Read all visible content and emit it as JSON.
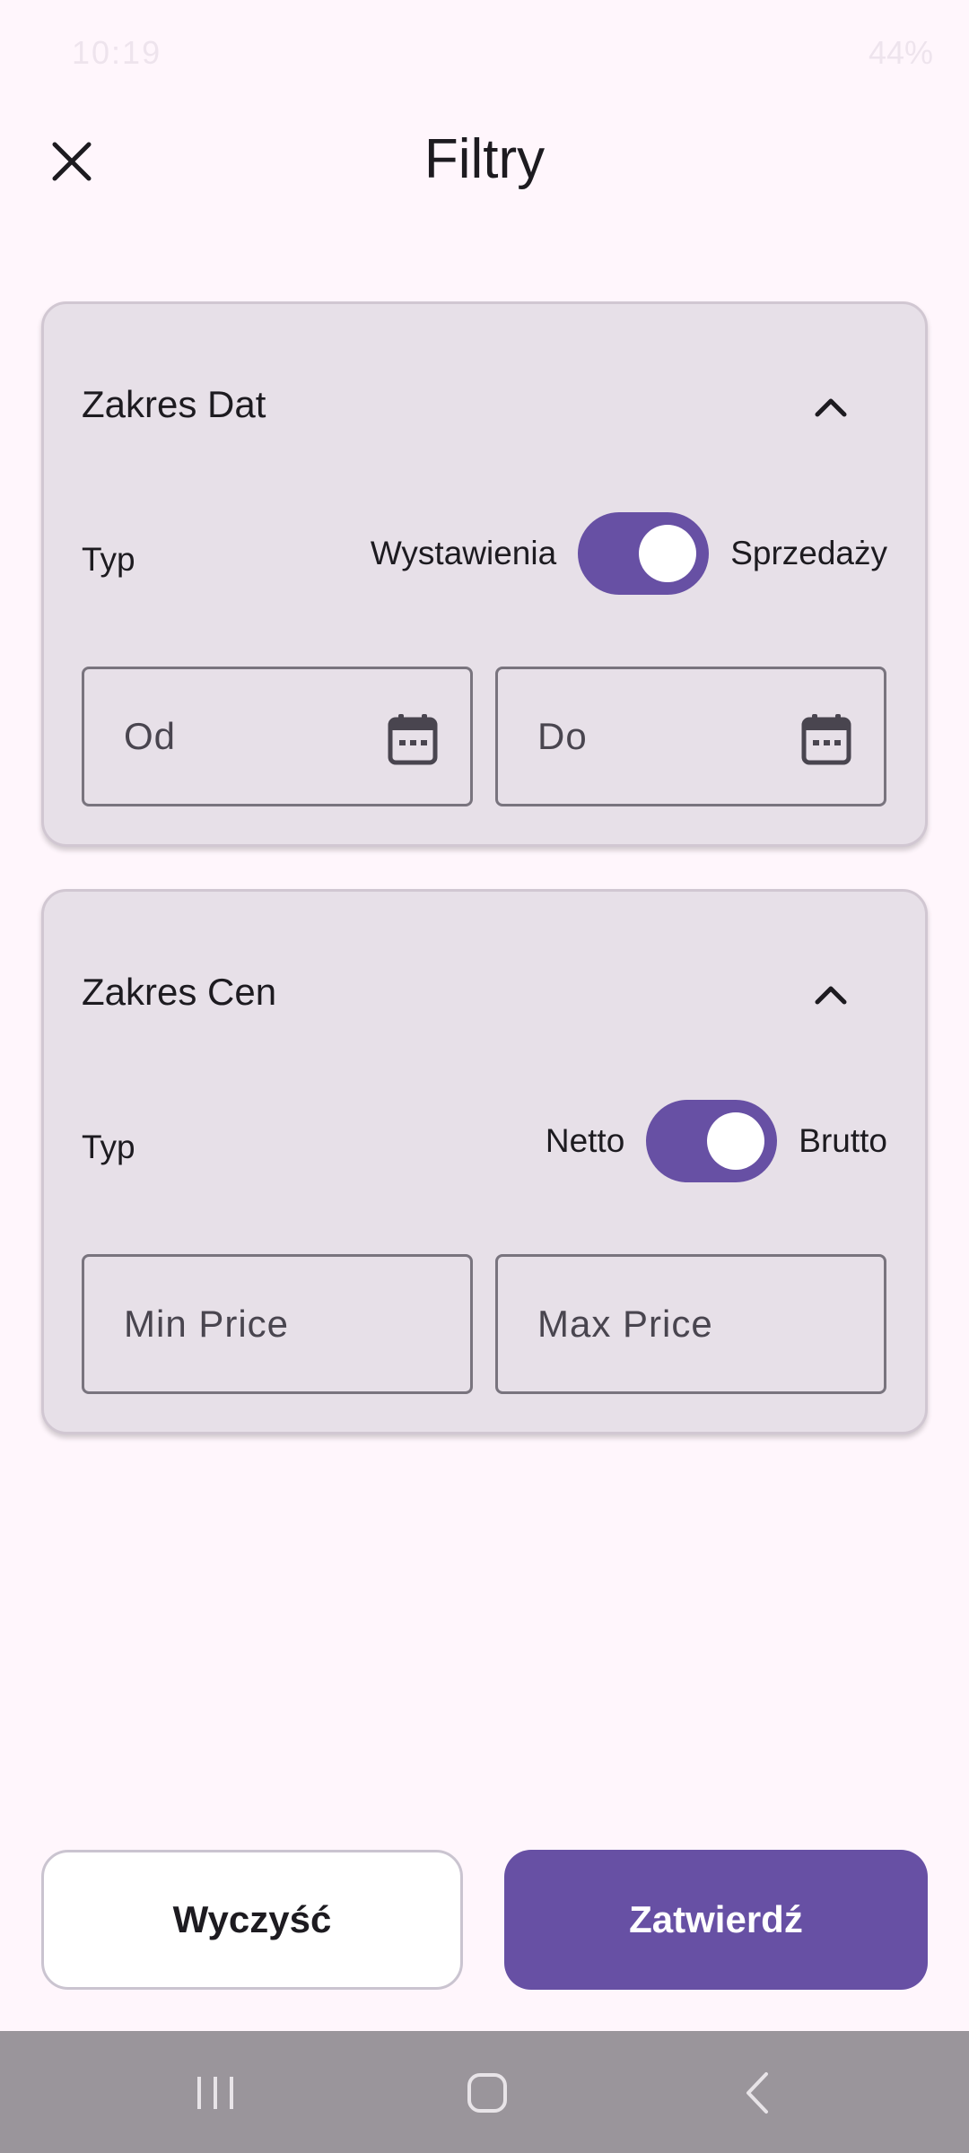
{
  "status_bar": {
    "time": "10:19",
    "battery": "44%"
  },
  "header": {
    "title": "Filtry"
  },
  "date_section": {
    "title": "Zakres Dat",
    "type_label": "Typ",
    "toggle_left": "Wystawienia",
    "toggle_right": "Sprzedaży",
    "toggle_on": true,
    "from_placeholder": "Od",
    "to_placeholder": "Do"
  },
  "price_section": {
    "title": "Zakres Cen",
    "type_label": "Typ",
    "toggle_left": "Netto",
    "toggle_right": "Brutto",
    "toggle_on": true,
    "min_placeholder": "Min Price",
    "max_placeholder": "Max Price"
  },
  "actions": {
    "clear_label": "Wyczyść",
    "confirm_label": "Zatwierdź"
  },
  "colors": {
    "accent": "#6750A4",
    "card_bg": "#E7E0E8",
    "page_bg": "#FFF6FC",
    "nav_bar_bg": "#9A959B"
  }
}
